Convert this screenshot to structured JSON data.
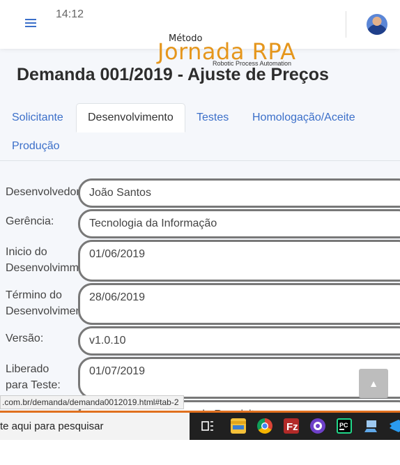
{
  "clock": "14:12",
  "logo": {
    "top": "Método",
    "main": "Jornada RPA",
    "sub": "Robotic Process Automation"
  },
  "title": "Demanda 001/2019 - Ajuste de Preços",
  "tabs": [
    {
      "label": "Solicitante"
    },
    {
      "label": "Desenvolvimento"
    },
    {
      "label": "Testes"
    },
    {
      "label": "Homologação/Aceite"
    },
    {
      "label": "Produção"
    }
  ],
  "fields": [
    {
      "label": "Desenvolvedor:",
      "value": "João Santos"
    },
    {
      "label": "Gerência:",
      "value": "Tecnologia da Informação"
    },
    {
      "label_l1": "Inicio do",
      "label_l2": "Desenvolvimmento:",
      "value": "01/06/2019"
    },
    {
      "label_l1": "Término do",
      "label_l2": "Desenvolvimento:",
      "value": "28/06/2019"
    },
    {
      "label": "Versão:",
      "value": "v1.0.10"
    },
    {
      "label_l1": "Liberado",
      "label_l2": "para Teste:",
      "value": "01/07/2019"
    },
    {
      "value": "de Requisitos"
    }
  ],
  "scroll_top_icon": "chevron-up-icon",
  "status_url": ".com.br/demanda/demanda0012019.html#tab-2",
  "taskbar": {
    "search_placeholder": "te aqui para pesquisar",
    "icons": [
      "task-view-icon",
      "file-explorer-icon",
      "chrome-icon",
      "filezilla-icon",
      "github-icon",
      "pycharm-icon",
      "remote-desktop-icon",
      "vscode-icon"
    ]
  }
}
